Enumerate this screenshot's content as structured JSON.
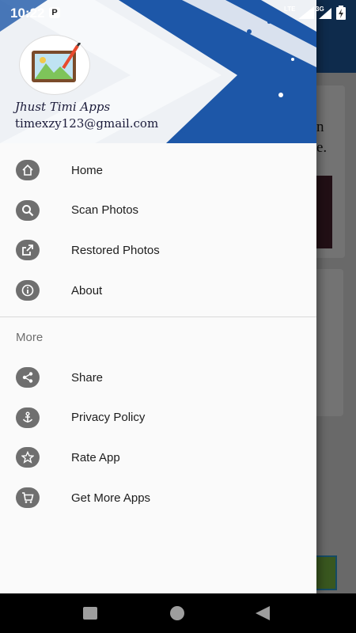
{
  "status_bar": {
    "time": "10:22",
    "notification_badge": "P",
    "network_1": "LTE",
    "network_2": "3G"
  },
  "drawer": {
    "header": {
      "app_name": "Jhust Timi Apps",
      "email": "timexzy123@gmail.com"
    },
    "items": [
      {
        "label": "Home",
        "icon": "home-icon"
      },
      {
        "label": "Scan Photos",
        "icon": "search-icon"
      },
      {
        "label": "Restored Photos",
        "icon": "share-out-icon"
      },
      {
        "label": "About",
        "icon": "info-icon"
      }
    ],
    "section_title": "More",
    "more_items": [
      {
        "label": "Share",
        "icon": "share-icon"
      },
      {
        "label": "Privacy Policy",
        "icon": "anchor-icon"
      },
      {
        "label": "Rate App",
        "icon": "star-icon"
      },
      {
        "label": "Get More Apps",
        "icon": "cart-icon"
      }
    ]
  },
  "background": {
    "text_line_1": "n",
    "text_line_2": "e."
  },
  "colors": {
    "toolbar": "#1f5fa8",
    "icon_bg": "#6f6f6f",
    "drawer_bg": "#fafafa"
  }
}
